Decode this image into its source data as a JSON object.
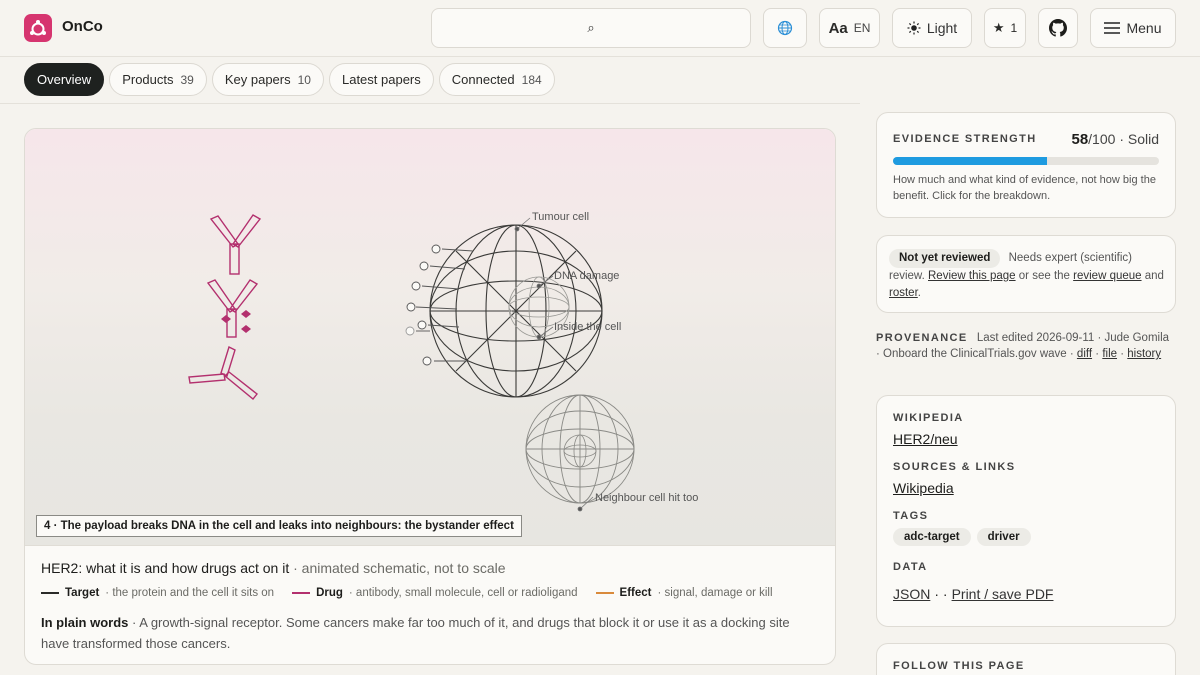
{
  "app": {
    "name": "OnCo",
    "brand_color": "#d6356f"
  },
  "header": {
    "search_icon": "⌕",
    "lang": {
      "aa": "Aa",
      "code": "EN"
    },
    "theme_label": "Light",
    "stars_count": "1",
    "menu_label": "Menu"
  },
  "tabs": [
    {
      "label": "Overview",
      "count": ""
    },
    {
      "label": "Products",
      "count": "39"
    },
    {
      "label": "Key papers",
      "count": "10"
    },
    {
      "label": "Latest papers",
      "count": ""
    },
    {
      "label": "Connected",
      "count": "184"
    }
  ],
  "viz": {
    "step": "4 · The payload breaks DNA in the cell and leaks into neighbours: the bystander effect",
    "labels": {
      "tumour": "Tumour cell",
      "dna": "DNA damage",
      "inside": "Inside the cell",
      "neighbour": "Neighbour cell hit too"
    },
    "title": "HER2: what it is and how drugs act on it",
    "subtitle": "· animated schematic, not to scale",
    "legend": [
      {
        "label": "Target",
        "desc": "· the protein and the cell it sits on",
        "color": "#2a2a28"
      },
      {
        "label": "Drug",
        "desc": "· antibody, small molecule, cell or radioligand",
        "color": "#b3306e"
      },
      {
        "label": "Effect",
        "desc": "· signal, damage or kill",
        "color": "#d98a3b"
      }
    ],
    "plain_label": "In plain words",
    "plain_text": "· A growth-signal receptor. Some cancers make far too much of it, and drugs that block it or use it as a docking site have transformed those cancers."
  },
  "evidence": {
    "title": "EVIDENCE STRENGTH",
    "score": "58",
    "max": "/100",
    "grade": "· Solid",
    "fill": 0.58,
    "desc": "How much and what kind of evidence, not how big the benefit. Click for the breakdown."
  },
  "review": {
    "pill": "Not yet reviewed",
    "text1": "Needs expert (scientific) review.",
    "link1": "Review this page",
    "text2": "or see the",
    "link2": "review queue",
    "text3": "and",
    "link3": "roster",
    "text4": "."
  },
  "provenance": {
    "label": "PROVENANCE",
    "text": "Last edited 2026-09-11 · Jude Gomila · Onboard the ClinicalTrials.gov wave ·",
    "link_diff": "diff",
    "sep": "·",
    "link_file": "file",
    "sep2": "·",
    "link_history": "history"
  },
  "info": {
    "wiki_h": "WIKIPEDIA",
    "wiki_v": "HER2/neu",
    "sources_h": "SOURCES & LINKS",
    "sources_v": "Wikipedia",
    "tags_h": "TAGS",
    "tags": [
      "adc-target",
      "driver"
    ],
    "data_h": "DATA",
    "data_json": "JSON",
    "data_sep": "· ·",
    "data_pdf": "Print / save PDF"
  },
  "follow": {
    "title": "FOLLOW THIS PAGE"
  }
}
